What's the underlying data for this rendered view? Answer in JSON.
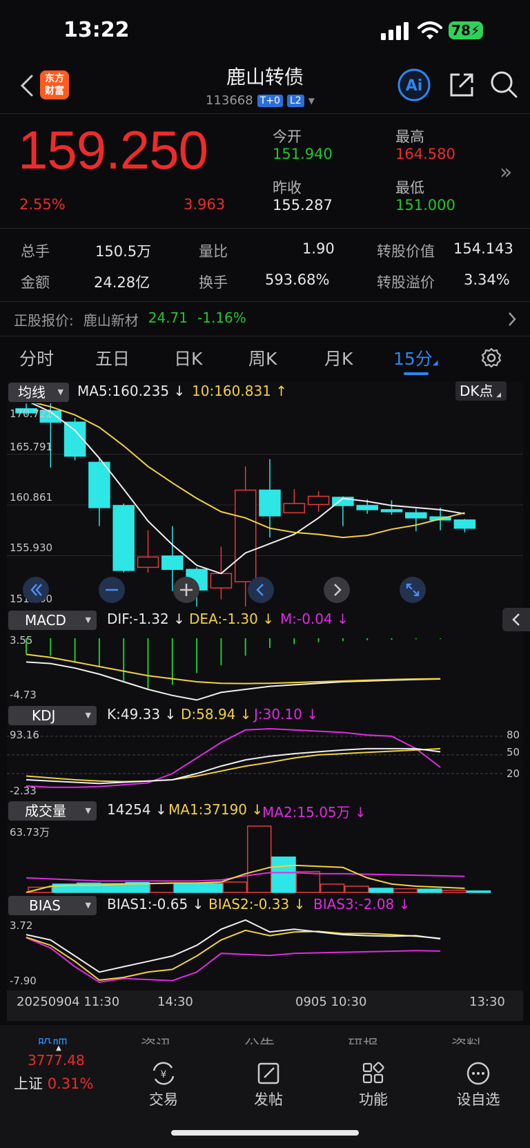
{
  "status": {
    "time": "13:22",
    "battery": "78"
  },
  "header": {
    "logo_line1": "东方",
    "logo_line2": "财富",
    "title": "鹿山转债",
    "code": "113668",
    "tag1": "T+0",
    "tag2": "L2"
  },
  "quote": {
    "price": "159.250",
    "pct": "2.55%",
    "change": "3.963",
    "open_label": "今开",
    "open": "151.940",
    "high_label": "最高",
    "high": "164.580",
    "prev_label": "昨收",
    "prev": "155.287",
    "low_label": "最低",
    "low": "151.000"
  },
  "stats": {
    "vol_label": "总手",
    "vol": "150.5万",
    "ratio_label": "量比",
    "ratio": "1.90",
    "convval_label": "转股价值",
    "convval": "154.143",
    "amt_label": "金额",
    "amt": "24.28亿",
    "turn_label": "换手",
    "turn": "593.68%",
    "prem_label": "转股溢价",
    "prem": "3.34%"
  },
  "underlying": {
    "label": "正股报价:",
    "name": "鹿山新材",
    "price": "24.71",
    "pct": "-1.16%"
  },
  "tabs": [
    "分时",
    "五日",
    "日K",
    "周K",
    "月K",
    "15分"
  ],
  "chart": {
    "ma_dropdown": "均线",
    "ma5": "MA5:160.235",
    "ma10": "10:160.831",
    "dk_label": "DK点",
    "price_axis": [
      "170.722",
      "165.791",
      "160.861",
      "155.930",
      "151.000"
    ],
    "macd_dropdown": "MACD",
    "dif": "DIF:-1.32",
    "dea": "DEA:-1.30",
    "m": "M:-0.04",
    "macd_axis": [
      "3.55",
      "-4.73"
    ],
    "kdj_dropdown": "KDJ",
    "k": "K:49.33",
    "d": "D:58.94",
    "j": "J:30.10",
    "kdj_axis": [
      "93.16",
      "-2.33"
    ],
    "kdj_right": [
      "80",
      "50",
      "20"
    ],
    "vol_dropdown": "成交量",
    "vol_now": "14254",
    "ma1": "MA1:37190",
    "ma2": "MA2:15.05万",
    "vol_axis": "63.73万",
    "bias_dropdown": "BIAS",
    "bias1": "BIAS1:-0.65",
    "bias2": "BIAS2:-0.33",
    "bias3": "BIAS3:-2.08",
    "bias_axis": [
      "3.72",
      "-7.90"
    ],
    "time_axis": [
      "20250904 11:30",
      "14:30",
      "0905 10:30",
      "13:30"
    ]
  },
  "chart_data": {
    "type": "candlestick",
    "y_range": [
      151.0,
      170.722
    ],
    "candles": [
      {
        "o": 170.2,
        "c": 169.8,
        "h": 170.7,
        "l": 169.6
      },
      {
        "o": 170.0,
        "c": 168.9,
        "h": 171.2,
        "l": 164.5
      },
      {
        "o": 168.9,
        "c": 165.6,
        "h": 169.3,
        "l": 165.2
      },
      {
        "o": 165.0,
        "c": 160.6,
        "h": 165.4,
        "l": 158.8
      },
      {
        "o": 160.8,
        "c": 154.5,
        "h": 161.0,
        "l": 154.3
      },
      {
        "o": 154.8,
        "c": 155.8,
        "h": 158.4,
        "l": 154.3
      },
      {
        "o": 155.9,
        "c": 154.6,
        "h": 158.8,
        "l": 152.5
      },
      {
        "o": 154.6,
        "c": 152.6,
        "h": 154.8,
        "l": 151.0
      },
      {
        "o": 152.8,
        "c": 154.2,
        "h": 156.8,
        "l": 151.7
      },
      {
        "o": 153.4,
        "c": 162.3,
        "h": 164.6,
        "l": 151.0
      },
      {
        "o": 162.3,
        "c": 159.8,
        "h": 165.3,
        "l": 157.7
      },
      {
        "o": 160.1,
        "c": 161.0,
        "h": 162.4,
        "l": 160.1
      },
      {
        "o": 160.9,
        "c": 161.7,
        "h": 162.2,
        "l": 160.2
      },
      {
        "o": 161.6,
        "c": 160.8,
        "h": 161.7,
        "l": 158.8
      },
      {
        "o": 160.8,
        "c": 160.4,
        "h": 161.4,
        "l": 160.0
      },
      {
        "o": 160.4,
        "c": 160.2,
        "h": 161.3,
        "l": 159.9
      },
      {
        "o": 160.1,
        "c": 159.6,
        "h": 160.5,
        "l": 158.3
      },
      {
        "o": 159.7,
        "c": 159.4,
        "h": 160.6,
        "l": 158.4
      },
      {
        "o": 159.4,
        "c": 158.6,
        "h": 159.5,
        "l": 158.2
      }
    ],
    "ma5": [
      171.0,
      169.9,
      168.1,
      165.4,
      162.4,
      159.3,
      157.0,
      155.0,
      154.2,
      156.2,
      157.1,
      158.0,
      159.6,
      161.5,
      161.2,
      160.8,
      160.6,
      160.4,
      160.0
    ],
    "ma10": [
      171.0,
      170.4,
      169.6,
      168.4,
      166.6,
      164.6,
      163.0,
      161.5,
      160.2,
      159.6,
      158.6,
      158.2,
      158.0,
      157.7,
      157.9,
      158.5,
      158.9,
      159.5,
      160.1
    ],
    "macd_bars": [
      -0.8,
      -0.9,
      -1.2,
      -1.5,
      -2.2,
      -2.6,
      -2.4,
      -1.8,
      -1.4,
      -0.9,
      -0.5,
      -0.3,
      -0.2,
      -0.15,
      -0.1,
      -0.08,
      -0.05,
      -0.04
    ],
    "volume": [
      5,
      8,
      9,
      8.5,
      9.5,
      8.5,
      9,
      8.5,
      10,
      63.73,
      34,
      20,
      8,
      6,
      4,
      3.5,
      3.2,
      2,
      1.4
    ],
    "volume_up": [
      true,
      false,
      false,
      false,
      false,
      true,
      false,
      false,
      true,
      true,
      false,
      true,
      true,
      true,
      false,
      true,
      false,
      true,
      false
    ],
    "vol_ma1": [
      0,
      6,
      7,
      7,
      8,
      8.5,
      9,
      9,
      10,
      18,
      24,
      26,
      25,
      24,
      14,
      8,
      6,
      5,
      4
    ],
    "vol_ma2": [
      14,
      13,
      12,
      11,
      11,
      11,
      11,
      11,
      12,
      16,
      19,
      19,
      18,
      18,
      17.5,
      17,
      16.5,
      16,
      15.5
    ],
    "kdj_k": [
      10,
      8,
      6,
      4,
      6,
      8,
      10,
      20,
      32,
      42,
      48,
      52,
      55,
      58,
      60,
      60,
      60,
      55
    ],
    "kdj_d": [
      16,
      13,
      10,
      8,
      7,
      8,
      10,
      16,
      24,
      32,
      38,
      45,
      50,
      52,
      54,
      56,
      58,
      60
    ],
    "kdj_j": [
      0,
      -2,
      -2,
      -1,
      2,
      5,
      20,
      45,
      70,
      90,
      92,
      90,
      88,
      86,
      82,
      80,
      60,
      30
    ],
    "bias1": [
      1,
      0,
      -3,
      -6,
      -5,
      -4,
      -3,
      -1,
      2,
      3.72,
      1.5,
      2,
      1.5,
      1,
      0.8,
      0.7,
      0.8,
      0.2
    ],
    "bias2": [
      0.5,
      -1,
      -4,
      -7.5,
      -7,
      -6,
      -5.5,
      -3,
      0,
      1.8,
      0.8,
      1.5,
      1.6,
      1.2,
      1.2,
      1.0,
      0.7,
      0.3
    ],
    "bias3": [
      0.4,
      -1.5,
      -5,
      -7.9,
      -7.2,
      -7.4,
      -7.6,
      -6,
      -2.5,
      -2.7,
      -2.9,
      -2.5,
      -2.4,
      -2.3,
      -2.2,
      -2.1,
      -2.0,
      -2.08
    ]
  },
  "bottom_nav": {
    "peek": [
      "股吧",
      "资讯",
      "公告",
      "研报",
      "资料"
    ],
    "index_value": "3777.48",
    "index_name": "上证",
    "index_pct": "0.31%",
    "trade": "交易",
    "post": "发帖",
    "func": "功能",
    "watch": "设自选"
  }
}
